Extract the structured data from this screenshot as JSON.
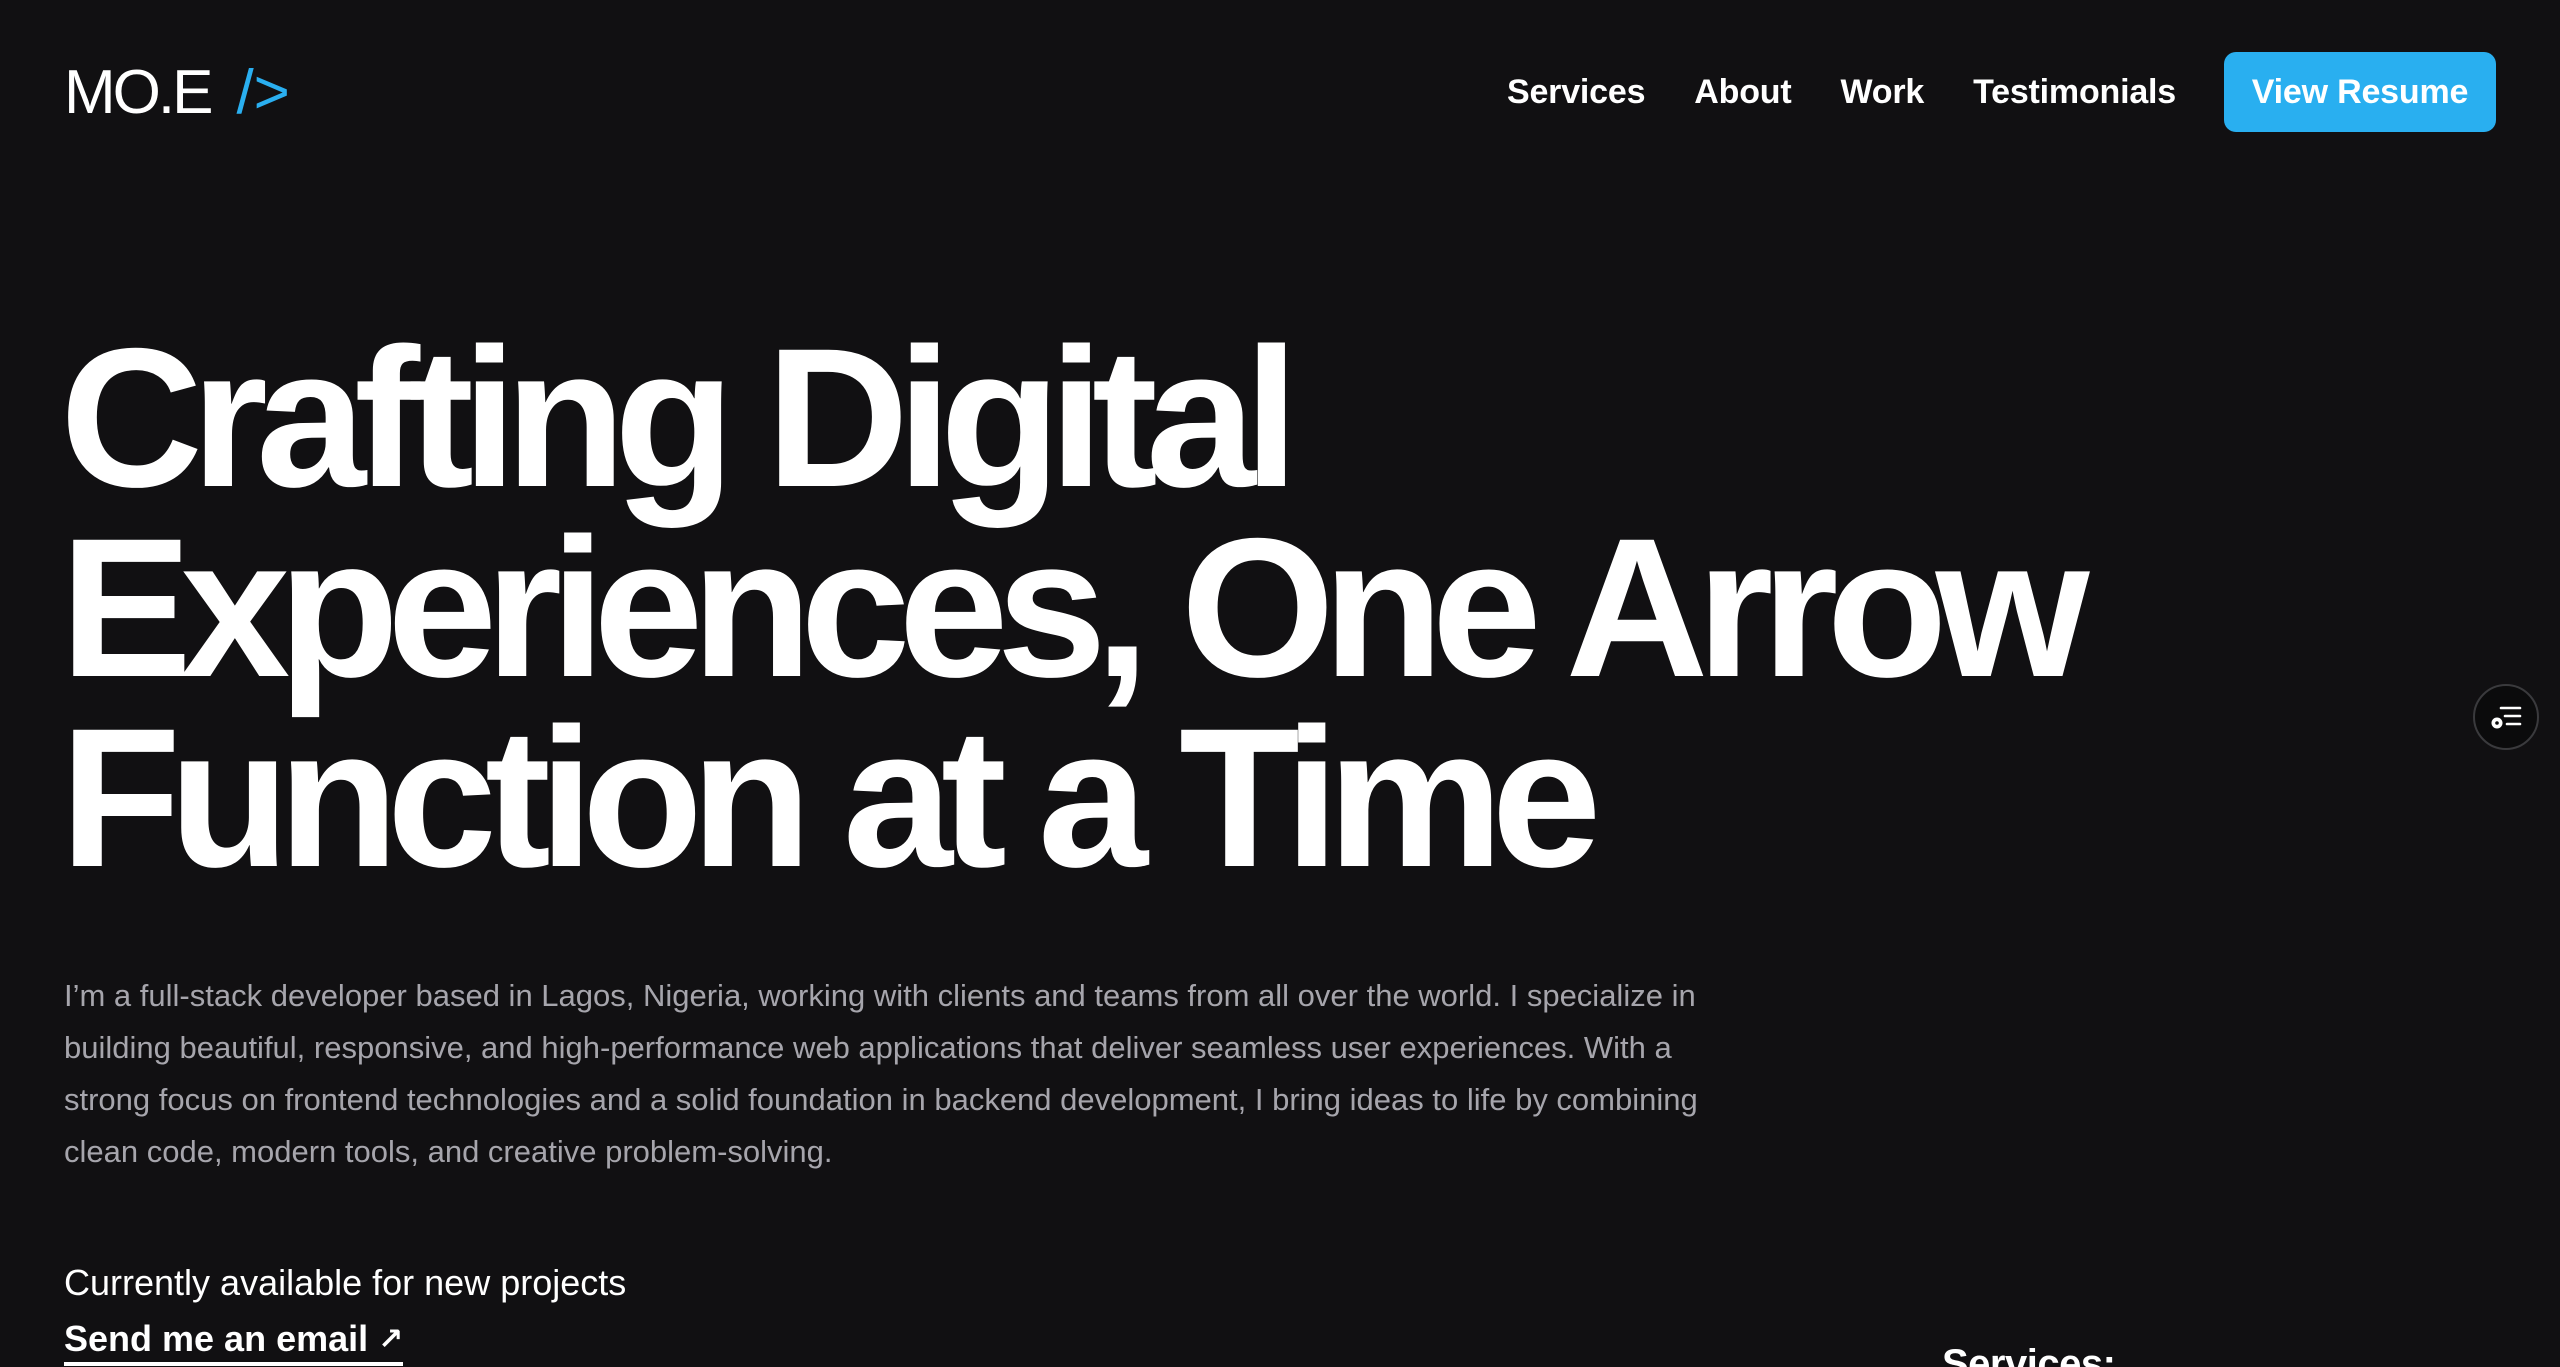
{
  "header": {
    "logo_text": "MO.E",
    "logo_accent": "/>",
    "nav": [
      "Services",
      "About",
      "Work",
      "Testimonials"
    ],
    "cta_label": "View Resume"
  },
  "hero": {
    "title_lines": [
      "Crafting Digital",
      "Experiences, One Arrow",
      "Function at a Time"
    ],
    "description": "I’m a  full-stack developer based in Lagos, Nigeria, working with clients and teams from all over the world. I specialize in building  beautiful, responsive, and high-performance web applications that deliver seamless user experiences. With a strong focus on  frontend technologies and a solid foundation in  backend development, I bring ideas to life by combining  clean code, modern tools, and creative problem-solving.",
    "availability": "Currently available for new projects",
    "email_label": "Send me an email",
    "email_arrow": "↗"
  },
  "services": {
    "heading": "Services:"
  },
  "widget": {
    "icon": "list-settings-icon"
  },
  "colors": {
    "background": "#111012",
    "accent": "#29aff0",
    "text_primary": "#ffffff",
    "text_muted": "#a6a5ac"
  }
}
